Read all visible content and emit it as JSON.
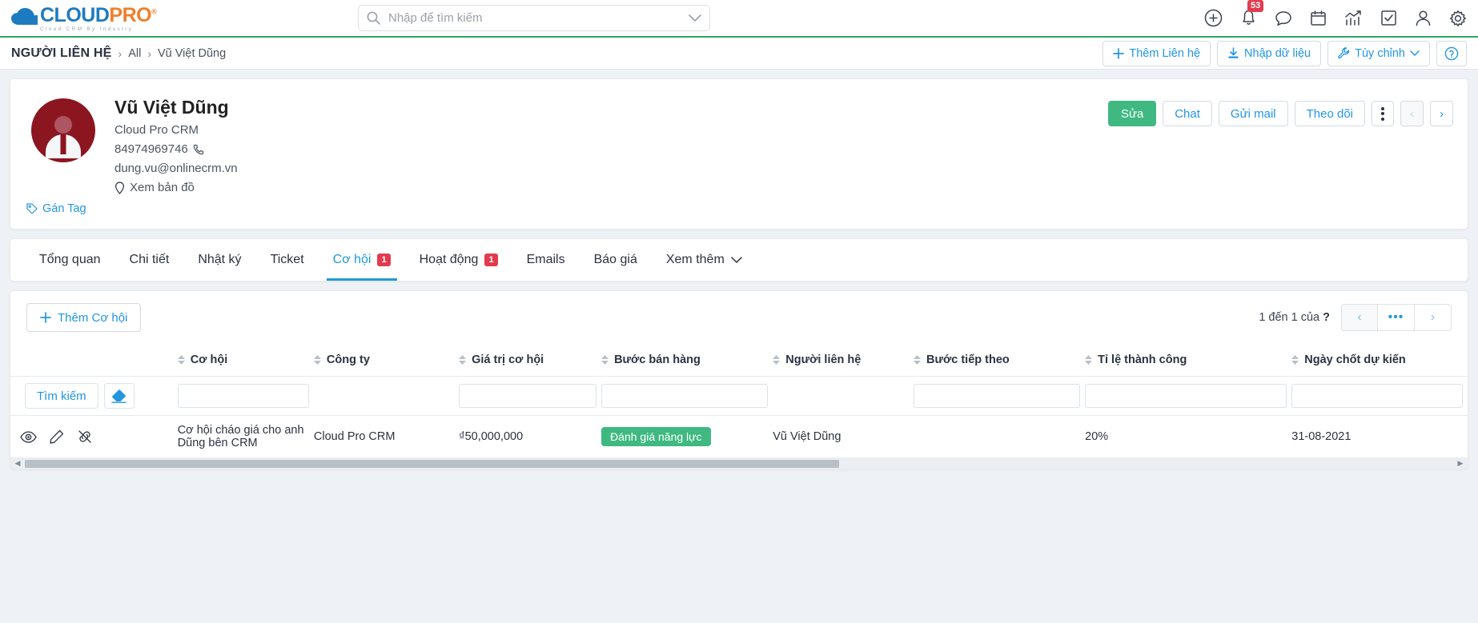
{
  "brand": {
    "name_part1": "CLOUD",
    "name_part2": "PRO",
    "registered": "®",
    "tagline": "Cloud CRM By Industry",
    "color_blue": "#1f7bc1",
    "color_orange": "#ef7f2a"
  },
  "topbar": {
    "search_placeholder": "Nhập để tìm kiếm",
    "search_value": "",
    "icons": [
      {
        "name": "plus-circle-icon"
      },
      {
        "name": "bell-icon",
        "badge": "53"
      },
      {
        "name": "chat-bubble-icon"
      },
      {
        "name": "calendar-icon"
      },
      {
        "name": "analytics-icon"
      },
      {
        "name": "task-check-icon"
      },
      {
        "name": "user-icon"
      },
      {
        "name": "gear-icon"
      }
    ],
    "notification_count": "53"
  },
  "breadcrumb": {
    "root": "NGƯỜI LIÊN HỆ",
    "separator": "›",
    "items": [
      "All",
      "Vũ Việt Dũng"
    ],
    "actions": [
      {
        "label": "Thêm Liên hệ",
        "icon": "plus-icon"
      },
      {
        "label": "Nhập dữ liệu",
        "icon": "import-icon"
      },
      {
        "label": "Tùy chỉnh",
        "icon": "wrench-icon",
        "caret": "⌄"
      },
      {
        "label": "",
        "icon": "help-circle-icon"
      }
    ]
  },
  "contact": {
    "name": "Vũ Việt Dũng",
    "company": "Cloud Pro CRM",
    "phone": "84974969746",
    "email": "dung.vu@onlinecrm.vn",
    "map_link": "Xem bản đồ",
    "tag_link": "Gán Tag",
    "avatar_color": "#8c1620",
    "actions": [
      {
        "label": "Sửa",
        "style": "primary"
      },
      {
        "label": "Chat",
        "style": "default"
      },
      {
        "label": "Gửi mail",
        "style": "default"
      },
      {
        "label": "Theo dõi",
        "style": "default"
      }
    ],
    "more_menu": "kebab-menu",
    "prev_label": "‹",
    "next_label": "›"
  },
  "tabs": [
    {
      "label": "Tổng quan",
      "badge": null,
      "active": false
    },
    {
      "label": "Chi tiết",
      "badge": null,
      "active": false
    },
    {
      "label": "Nhật ký",
      "badge": null,
      "active": false
    },
    {
      "label": "Ticket",
      "badge": null,
      "active": false
    },
    {
      "label": "Cơ hội",
      "badge": "1",
      "active": true
    },
    {
      "label": "Hoạt động",
      "badge": "1",
      "active": false
    },
    {
      "label": "Emails",
      "badge": null,
      "active": false
    },
    {
      "label": "Báo giá",
      "badge": null,
      "active": false
    },
    {
      "label": "Xem thêm",
      "badge": null,
      "active": false,
      "caret": "⌄"
    }
  ],
  "list": {
    "add_button": "Thêm Cơ hội",
    "pager_text_prefix": "1 đến 1 của",
    "pager_total": "?",
    "pager_prev": "‹",
    "pager_mid": "•••",
    "pager_next": "›",
    "search_button": "Tìm kiếm",
    "clear_button_icon": "eraser-icon",
    "columns": [
      "Cơ hội",
      "Công ty",
      "Giá trị cơ hội",
      "Bước bán hàng",
      "Người liên hệ",
      "Bước tiếp theo",
      "Tỉ lệ thành công",
      "Ngày chốt dự kiến"
    ],
    "filters": [
      "",
      "",
      "",
      "",
      "",
      "",
      "",
      ""
    ],
    "rows": [
      {
        "actions": [
          "view-icon",
          "edit-icon",
          "unlink-icon"
        ],
        "opportunity": "Cơ hội cháo giá cho anh Dũng bên CRM",
        "company": "Cloud Pro CRM",
        "value": "₫50,000,000",
        "stage": "Đánh giá năng lực",
        "stage_color": "#3fb981",
        "contact": "Vũ Việt Dũng",
        "next_step": "",
        "win_rate": "20%",
        "close_date": "31-08-2021"
      }
    ]
  }
}
